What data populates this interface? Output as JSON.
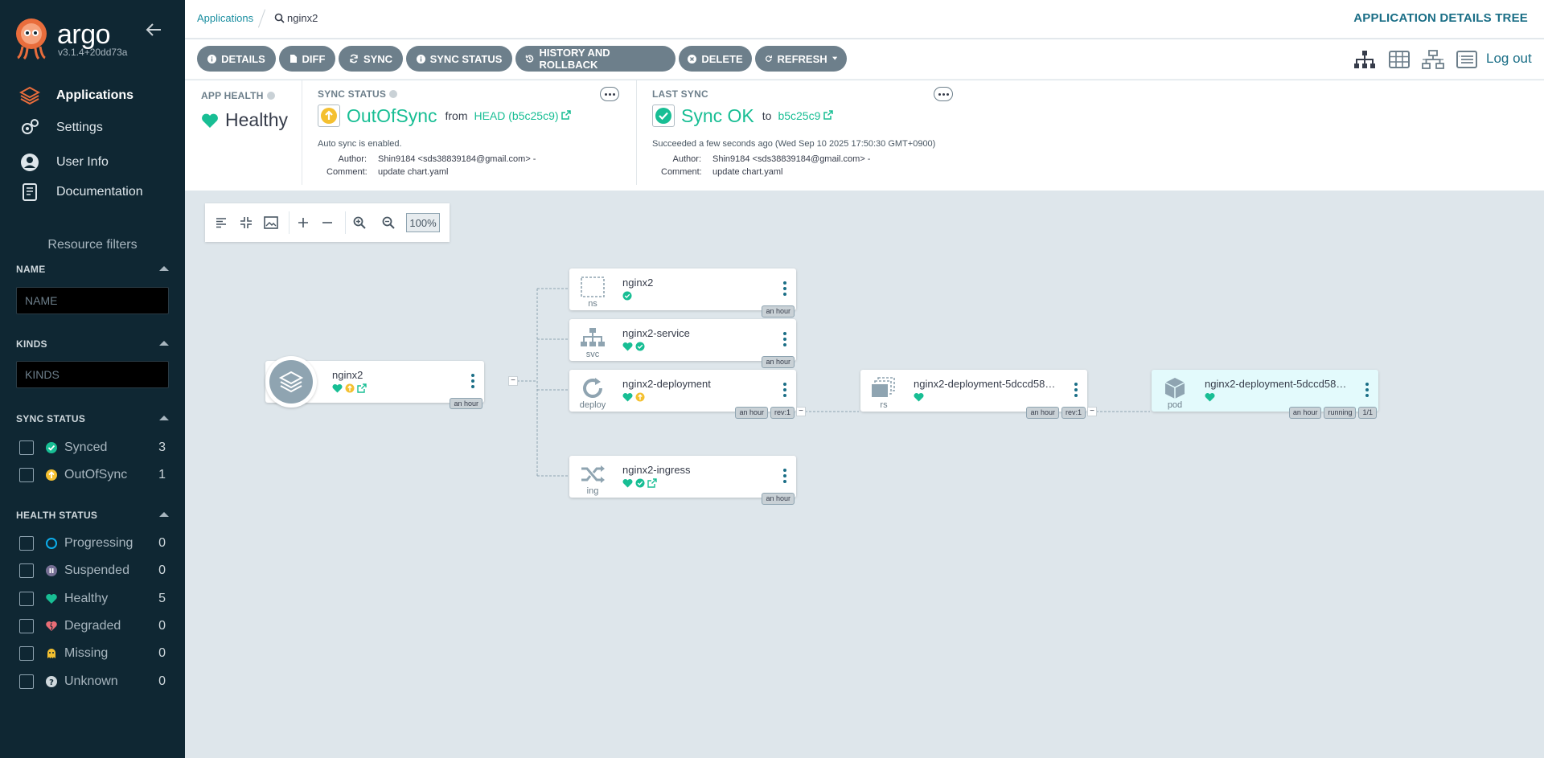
{
  "sidebar": {
    "logo_text": "argo",
    "version": "v3.1.4+20dd73a",
    "nav": [
      {
        "label": "Applications"
      },
      {
        "label": "Settings"
      },
      {
        "label": "User Info"
      },
      {
        "label": "Documentation"
      }
    ],
    "filters_title": "Resource filters",
    "name_section": {
      "title": "NAME",
      "placeholder": "NAME"
    },
    "kinds_section": {
      "title": "KINDS",
      "placeholder": "KINDS"
    },
    "sync_status": {
      "title": "SYNC STATUS",
      "items": [
        {
          "label": "Synced",
          "count": "3"
        },
        {
          "label": "OutOfSync",
          "count": "1"
        }
      ]
    },
    "health_status": {
      "title": "HEALTH STATUS",
      "items": [
        {
          "label": "Progressing",
          "count": "0"
        },
        {
          "label": "Suspended",
          "count": "0"
        },
        {
          "label": "Healthy",
          "count": "5"
        },
        {
          "label": "Degraded",
          "count": "0"
        },
        {
          "label": "Missing",
          "count": "0"
        },
        {
          "label": "Unknown",
          "count": "0"
        }
      ]
    }
  },
  "topbar": {
    "breadcrumb": "Applications",
    "search_text": "nginx2",
    "page_title": "APPLICATION DETAILS TREE"
  },
  "toolbar": {
    "buttons": [
      "DETAILS",
      "DIFF",
      "SYNC",
      "SYNC STATUS",
      "HISTORY AND ROLLBACK",
      "DELETE",
      "REFRESH"
    ],
    "logout": "Log out"
  },
  "summary": {
    "app_health": {
      "label": "APP HEALTH",
      "value": "Healthy"
    },
    "sync_status": {
      "label": "SYNC STATUS",
      "value": "OutOfSync",
      "from_text": "from",
      "revision": "HEAD (b5c25c9)",
      "auto_sync": "Auto sync is enabled.",
      "author_label": "Author:",
      "author": "Shin9184 <sds38839184@gmail.com> -",
      "comment_label": "Comment:",
      "comment": "update chart.yaml"
    },
    "last_sync": {
      "label": "LAST SYNC",
      "value": "Sync OK",
      "to_text": "to",
      "revision": "b5c25c9",
      "succeeded": "Succeeded a few seconds ago (Wed Sep 10 2025 17:50:30 GMT+0900)",
      "author_label": "Author:",
      "author": "Shin9184 <sds38839184@gmail.com> -",
      "comment_label": "Comment:",
      "comment": "update chart.yaml"
    }
  },
  "canvas": {
    "zoom": "100%",
    "app": {
      "name": "nginx2",
      "age": "an hour"
    },
    "nodes": [
      {
        "name": "nginx2",
        "kind": "ns",
        "age": "an hour"
      },
      {
        "name": "nginx2-service",
        "kind": "svc",
        "age": "an hour"
      },
      {
        "name": "nginx2-deployment",
        "kind": "deploy",
        "age": "an hour",
        "rev": "rev:1"
      },
      {
        "name": "nginx2-ingress",
        "kind": "ing",
        "age": "an hour"
      },
      {
        "name": "nginx2-deployment-5dccd589...",
        "kind": "rs",
        "age": "an hour",
        "rev": "rev:1"
      },
      {
        "name": "nginx2-deployment-5dccd589...",
        "kind": "pod",
        "age": "an hour",
        "status": "running",
        "ready": "1/1"
      }
    ]
  },
  "colors": {
    "sidebar_bg": "#0f2733",
    "healthy": "#18be94",
    "out_of_sync": "#f4c030",
    "accent": "#1a6e86",
    "button": "#6d7f8b"
  }
}
